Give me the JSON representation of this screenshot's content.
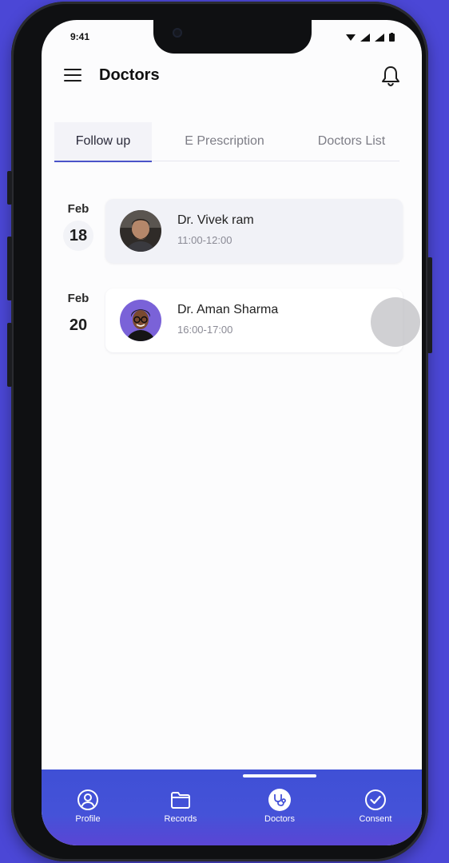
{
  "status": {
    "time": "9:41"
  },
  "header": {
    "title": "Doctors"
  },
  "tabs": [
    {
      "label": "Follow up",
      "active": true
    },
    {
      "label": "E Prescription",
      "active": false
    },
    {
      "label": "Doctors List",
      "active": false
    }
  ],
  "appointments": [
    {
      "month": "Feb",
      "day": "18",
      "doctor": "Dr. Vivek ram",
      "time": "11:00-12:00",
      "avatar": "bearded-man-avatar",
      "highlighted": true
    },
    {
      "month": "Feb",
      "day": "20",
      "doctor": "Dr. Aman Sharma",
      "time": "16:00-17:00",
      "avatar": "man-with-glasses-avatar",
      "highlighted": false
    }
  ],
  "bottom_nav": [
    {
      "label": "Profile",
      "icon": "user-circle-icon"
    },
    {
      "label": "Records",
      "icon": "folder-icon"
    },
    {
      "label": "Doctors",
      "icon": "stethoscope-icon",
      "active": true
    },
    {
      "label": "Consent",
      "icon": "check-circle-icon"
    }
  ],
  "colors": {
    "accent": "#4a54c9",
    "nav_bg": "#4552d8",
    "background": "#4b47d6"
  }
}
